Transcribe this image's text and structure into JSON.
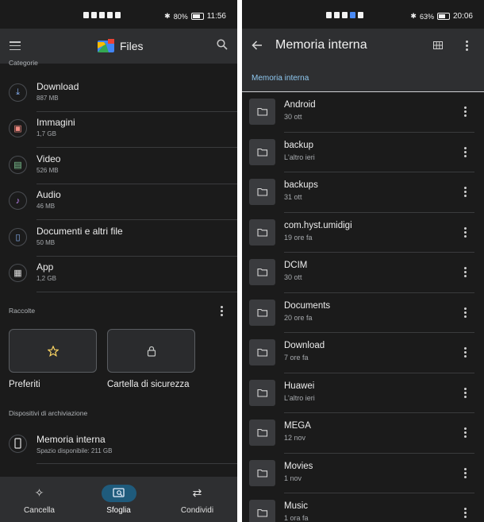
{
  "left": {
    "status": {
      "battery": "80%",
      "time": "11:56",
      "battery_level": 0.8
    },
    "app_title": "Files",
    "categories_label": "Categorie",
    "categories": [
      {
        "name": "Download",
        "size": "887 MB",
        "icon": "download-icon",
        "color": "#8ab4f8"
      },
      {
        "name": "Immagini",
        "size": "1,7 GB",
        "icon": "image-icon",
        "color": "#f28b82"
      },
      {
        "name": "Video",
        "size": "526 MB",
        "icon": "video-icon",
        "color": "#81c995"
      },
      {
        "name": "Audio",
        "size": "46 MB",
        "icon": "music-icon",
        "color": "#c58af9"
      },
      {
        "name": "Documenti e altri file",
        "size": "50 MB",
        "icon": "document-icon",
        "color": "#8ab4f8"
      },
      {
        "name": "App",
        "size": "1,2 GB",
        "icon": "app-icon",
        "color": "#e0e0e0"
      }
    ],
    "collections_label": "Raccolte",
    "collections": [
      {
        "name": "Preferiti",
        "icon": "star-icon",
        "color": "#fdd663"
      },
      {
        "name": "Cartella di sicurezza",
        "icon": "lock-icon",
        "color": "#c4c7c5"
      }
    ],
    "storage_label": "Dispositivi di archiviazione",
    "storage": {
      "name": "Memoria interna",
      "free": "Spazio disponibile: 211 GB"
    },
    "nav": [
      {
        "label": "Cancella",
        "icon": "sparkle-icon"
      },
      {
        "label": "Sfoglia",
        "icon": "browse-icon",
        "active": true
      },
      {
        "label": "Condividi",
        "icon": "swap-icon"
      }
    ]
  },
  "right": {
    "status": {
      "battery": "63%",
      "time": "20:06",
      "battery_level": 0.63
    },
    "title": "Memoria interna",
    "breadcrumb": "Memoria interna",
    "folders": [
      {
        "name": "Android",
        "date": "30 ott"
      },
      {
        "name": "backup",
        "date": "L'altro ieri"
      },
      {
        "name": "backups",
        "date": "31 ott"
      },
      {
        "name": "com.hyst.umidigi",
        "date": "19 ore fa"
      },
      {
        "name": "DCIM",
        "date": "30 ott"
      },
      {
        "name": "Documents",
        "date": "20 ore fa"
      },
      {
        "name": "Download",
        "date": "7 ore fa"
      },
      {
        "name": "Huawei",
        "date": "L'altro ieri"
      },
      {
        "name": "MEGA",
        "date": "12 nov"
      },
      {
        "name": "Movies",
        "date": "1 nov"
      },
      {
        "name": "Music",
        "date": "1 ora fa"
      }
    ]
  },
  "colors": {
    "background": "#1b1b1b",
    "bar": "#2e2f31",
    "accent": "#8fc8f0",
    "active_pill": "#1f5b7c"
  }
}
